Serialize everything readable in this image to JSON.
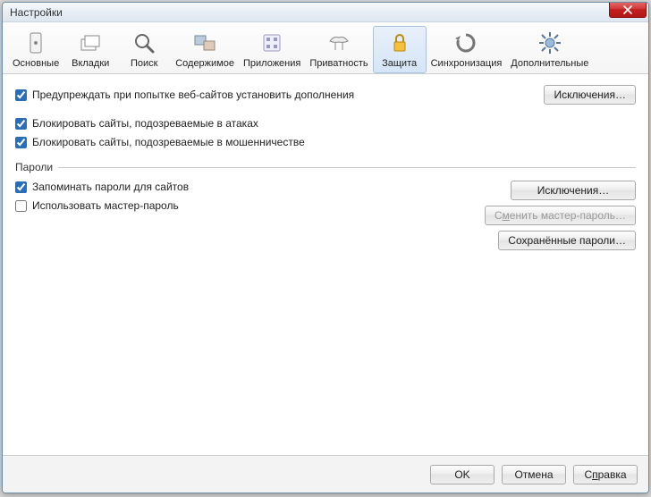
{
  "window": {
    "title": "Настройки"
  },
  "toolbar": {
    "items": [
      {
        "label": "Основные",
        "icon": "general"
      },
      {
        "label": "Вкладки",
        "icon": "tabs"
      },
      {
        "label": "Поиск",
        "icon": "search"
      },
      {
        "label": "Содержимое",
        "icon": "content"
      },
      {
        "label": "Приложения",
        "icon": "applications"
      },
      {
        "label": "Приватность",
        "icon": "privacy"
      },
      {
        "label": "Защита",
        "icon": "security",
        "active": true
      },
      {
        "label": "Синхронизация",
        "icon": "sync"
      },
      {
        "label": "Дополнительные",
        "icon": "advanced"
      }
    ]
  },
  "security": {
    "warn_addons": {
      "label": "Предупреждать при попытке веб-сайтов установить дополнения",
      "checked": true
    },
    "block_attacks": {
      "label": "Блокировать сайты, подозреваемые в атаках",
      "checked": true
    },
    "block_fraud": {
      "label": "Блокировать сайты, подозреваемые в мошенничестве",
      "checked": true
    },
    "exceptions_btn": "Исключения…"
  },
  "passwords": {
    "section_label": "Пароли",
    "remember": {
      "label": "Запоминать пароли для сайтов",
      "checked": true
    },
    "master": {
      "label": "Использовать мастер-пароль",
      "checked": false
    },
    "exceptions_btn": "Исключения…",
    "change_master_btn_prefix": "С",
    "change_master_btn_accesskey": "м",
    "change_master_btn_suffix": "енить мастер-пароль…",
    "saved_btn": "Сохранённые пароли…"
  },
  "footer": {
    "ok": "OK",
    "cancel": "Отмена",
    "help_prefix": "С",
    "help_accesskey": "п",
    "help_suffix": "равка"
  }
}
